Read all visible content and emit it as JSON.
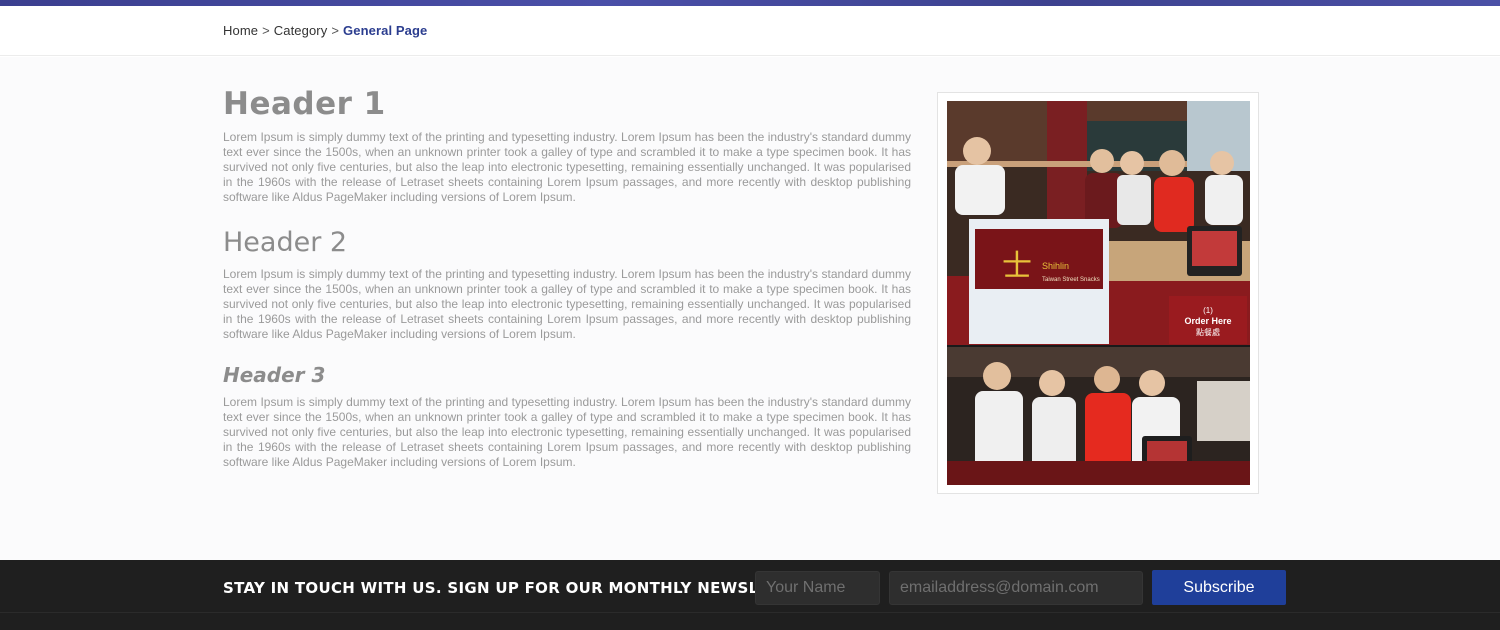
{
  "breadcrumb": {
    "items": [
      "Home",
      "Category"
    ],
    "separator": ">",
    "current": "General Page"
  },
  "content": {
    "header1": "Header 1",
    "header2": "Header 2",
    "header3": "Header 3",
    "paragraph": "Lorem Ipsum is simply dummy text of the printing and typesetting industry. Lorem Ipsum has been the industry's standard dummy text ever since the 1500s, when an unknown printer took a galley of type and scrambled it to make a type specimen book. It has survived not only five centuries, but also the leap into electronic typesetting, remaining essentially unchanged. It was popularised in the 1960s with the release of Letraset sheets containing Lorem Ipsum passages, and more recently with desktop publishing software like Aldus PageMaker including versions of Lorem Ipsum."
  },
  "photo": {
    "sign_text": "Shihlin",
    "sign_subtext": "Taiwan Street Snacks",
    "order_number": "(1)",
    "order_text": "Order Here",
    "order_chinese": "點餐處"
  },
  "footer": {
    "newsletter_label": "STAY IN TOUCH WITH US. SIGN UP FOR OUR MONTHLY NEWSLETTER:",
    "name_placeholder": "Your Name",
    "email_placeholder": "emailaddress@domain.com",
    "subscribe_label": "Subscribe"
  },
  "colors": {
    "accent": "#1f3f9a",
    "breadcrumb_current": "#2b3d8f",
    "footer_bg": "#1f1f1f",
    "heading": "#8c8c8c"
  }
}
